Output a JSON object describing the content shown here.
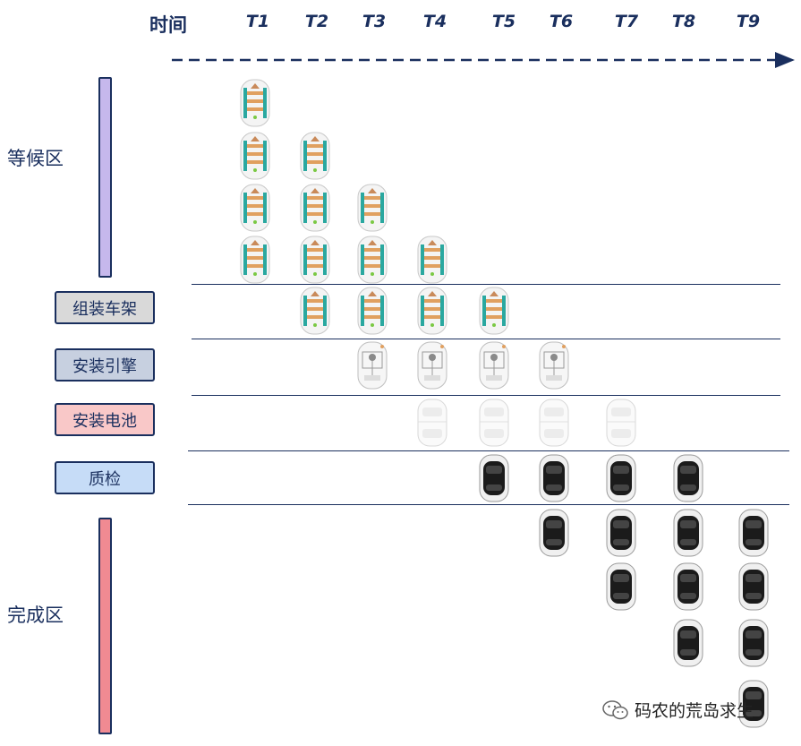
{
  "header": {
    "time_label": "时间",
    "ticks": [
      "T1",
      "T2",
      "T3",
      "T4",
      "T5",
      "T6",
      "T7",
      "T8",
      "T9"
    ]
  },
  "zones": {
    "waiting": "等候区",
    "completed": "完成区"
  },
  "stages": [
    {
      "label": "组装车架",
      "fill": "#d9d9d9"
    },
    {
      "label": "安装引擎",
      "fill": "#c7d0e0"
    },
    {
      "label": "安装电池",
      "fill": "#f9c8c8"
    },
    {
      "label": "质检",
      "fill": "#c6dcf7"
    }
  ],
  "colors": {
    "navy": "#1a2f5e",
    "waiting_bar": "#c6b8ec",
    "completed_bar": "#f08a92"
  },
  "items": {
    "waiting": [
      4,
      3,
      2,
      1,
      0,
      0,
      0,
      0,
      0
    ],
    "frame": [
      0,
      1,
      1,
      1,
      1,
      0,
      0,
      0,
      0
    ],
    "engine": [
      0,
      0,
      1,
      1,
      1,
      1,
      0,
      0,
      0
    ],
    "battery": [
      0,
      0,
      0,
      1,
      1,
      1,
      1,
      0,
      0
    ],
    "qc": [
      0,
      0,
      0,
      0,
      1,
      1,
      1,
      1,
      0
    ],
    "done": [
      0,
      0,
      0,
      0,
      0,
      1,
      2,
      3,
      4
    ]
  },
  "watermark": "码农的荒岛求生"
}
